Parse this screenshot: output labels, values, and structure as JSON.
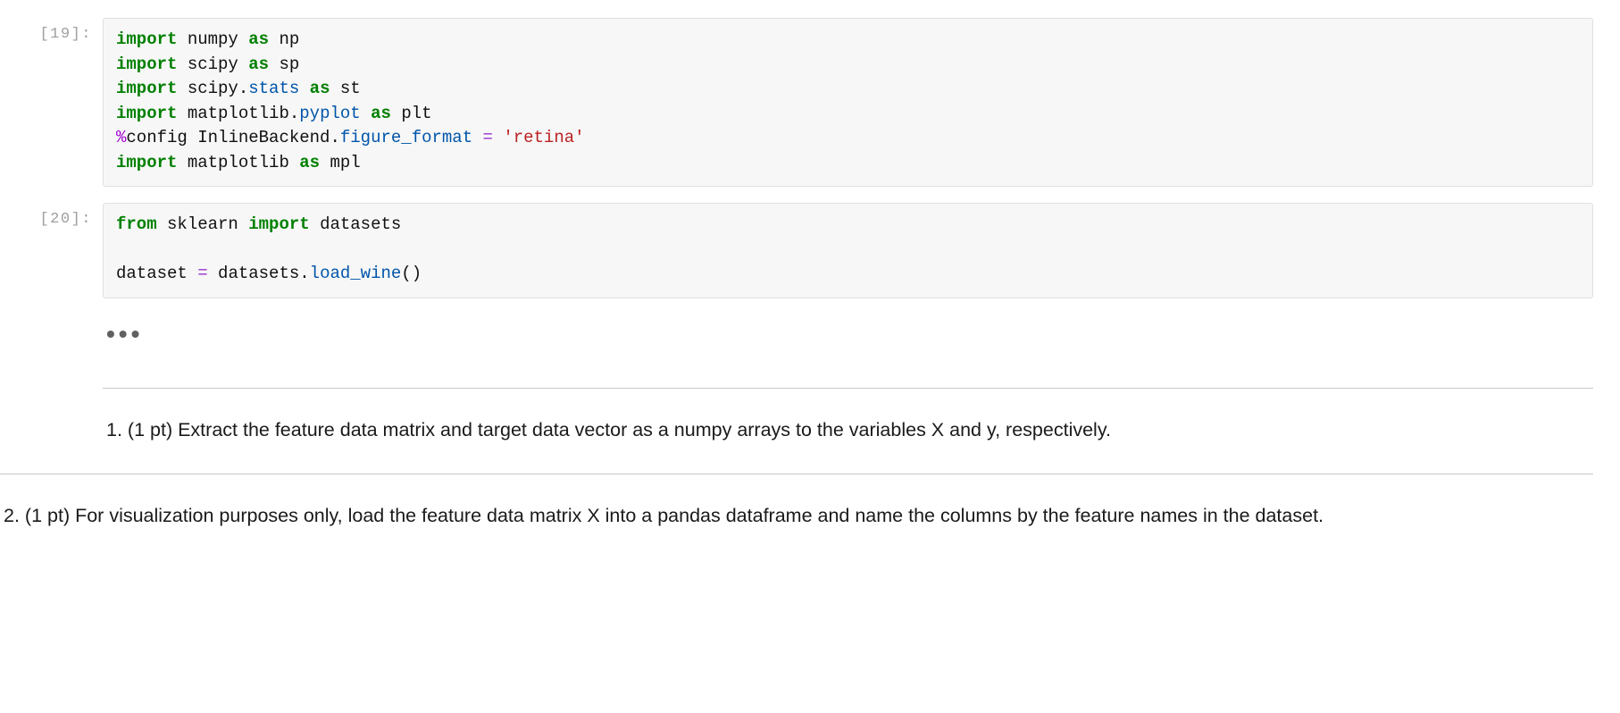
{
  "cells": {
    "c19": {
      "prompt": "[19]:",
      "code": {
        "l0": {
          "kw0": "import",
          "m0": "numpy",
          "kw1": "as",
          "m1": "np"
        },
        "l1": {
          "kw0": "import",
          "m0": "scipy",
          "kw1": "as",
          "m1": "sp"
        },
        "l2": {
          "kw0": "import",
          "m0": "scipy",
          "dot": ".",
          "attr": "stats",
          "kw1": "as",
          "m1": "st"
        },
        "l3": {
          "kw0": "import",
          "m0": "matplotlib",
          "dot": ".",
          "attr": "pyplot",
          "kw1": "as",
          "m1": "plt"
        },
        "l4": {
          "magic": "%",
          "cfg": "config",
          "back": "InlineBackend",
          "dot": ".",
          "attr": "figure_format",
          "eq": "=",
          "str": "'retina'"
        },
        "l5": {
          "kw0": "import",
          "m0": "matplotlib",
          "kw1": "as",
          "m1": "mpl"
        }
      }
    },
    "c20": {
      "prompt": "[20]:",
      "code": {
        "l0": {
          "kw0": "from",
          "m0": "sklearn",
          "kw1": "import",
          "m1": "datasets"
        },
        "l1": {
          "var": "dataset",
          "eq": "=",
          "mod": "datasets",
          "dot": ".",
          "func": "load_wine",
          "paren": "()"
        }
      }
    }
  },
  "markdown": {
    "dots": "•••",
    "q1": {
      "num": "1.",
      "pts": "(1 pt)",
      "text": "Extract the feature data matrix and target data vector as a numpy arrays to the variables X and y, respectively."
    },
    "q2": {
      "num": "2.",
      "pts": "(1 pt)",
      "text": "For visualization purposes only, load the feature data matrix X into a pandas dataframe and name the columns by the feature names in the dataset."
    }
  }
}
